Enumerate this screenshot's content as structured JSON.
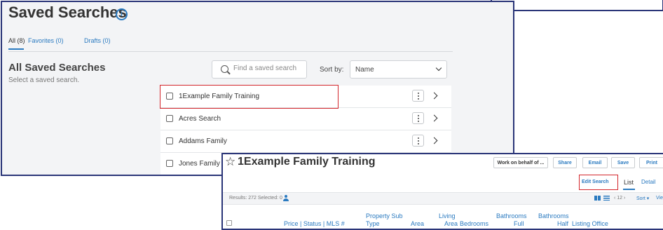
{
  "saved_searches": {
    "title": "Saved Searches",
    "info_glyph": "i",
    "tabs": [
      {
        "label": "All (8)"
      },
      {
        "label": "Favorites (0)"
      },
      {
        "label": "Drafts (0)"
      }
    ],
    "section_title": "All Saved Searches",
    "section_subtitle": "Select a saved search.",
    "search": {
      "placeholder": "Find a saved search"
    },
    "sort": {
      "label": "Sort by:",
      "value": "Name"
    },
    "items": [
      {
        "label": "1Example Family Training"
      },
      {
        "label": "Acres Search"
      },
      {
        "label": "Addams Family"
      },
      {
        "label": "Jones Family"
      }
    ]
  },
  "detail": {
    "star_glyph": "☆",
    "title": "1Example Family Training",
    "toolbar": {
      "work_on_behalf": "Work on behalf of ...",
      "share": "Share",
      "email": "Email",
      "save": "Save",
      "print": "Print"
    },
    "edit_search": "Edit Search",
    "views": {
      "list": "List",
      "detail": "Detail"
    },
    "results_text": "Results: 272   Selected: 0",
    "pager": "‹  12  ›",
    "sort_label": "Sort ▾",
    "view_truncated": "Vie",
    "columns": {
      "price_status": "Price | Status | MLS #",
      "property_sub_type_1": "Property Sub",
      "property_sub_type_2": "Type",
      "area": "Area",
      "living_area_1": "Living",
      "living_area_2": "Area",
      "bedrooms": "Bedrooms",
      "bathrooms_full_1": "Bathrooms",
      "bathrooms_full_2": "Full",
      "bathrooms_half_1": "Bathrooms",
      "bathrooms_half_2": "Half",
      "listing_office": "Listing Office"
    }
  },
  "colors": {
    "frame": "#2a3578",
    "accent": "#2a7ac0",
    "highlight": "#d3252b",
    "panel_bg": "#f3f4f6"
  }
}
